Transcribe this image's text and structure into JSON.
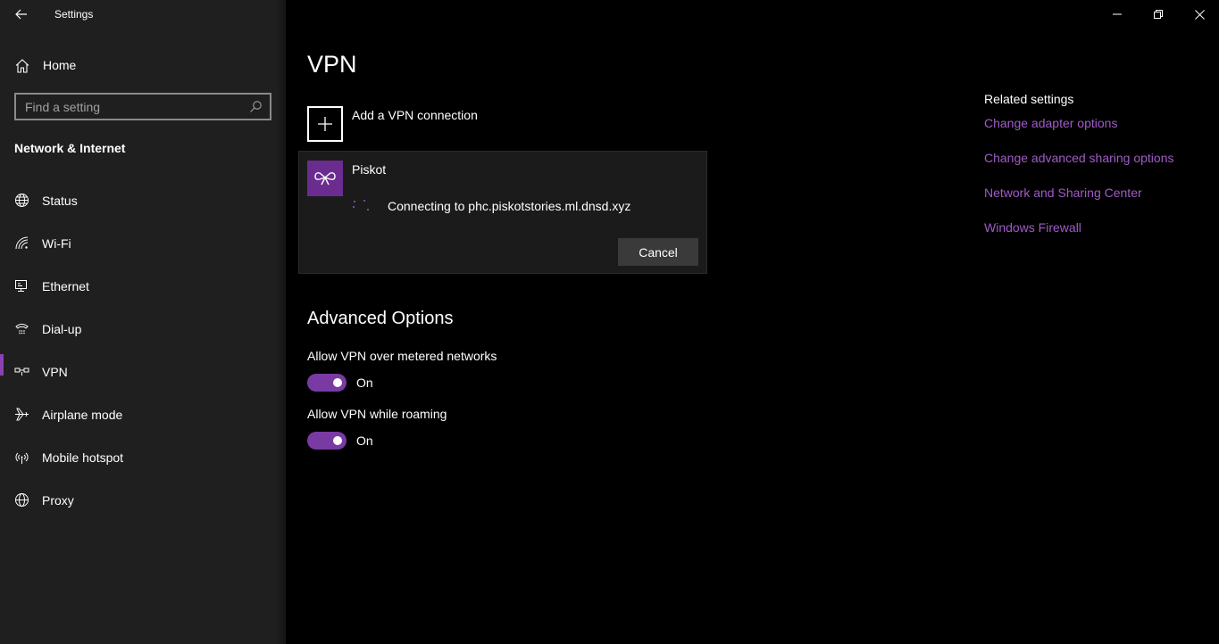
{
  "window": {
    "app_title": "Settings",
    "controls": [
      "minimize-icon",
      "restore-icon",
      "close-icon"
    ]
  },
  "sidebar": {
    "home_label": "Home",
    "search_placeholder": "Find a setting",
    "section_title": "Network & Internet",
    "items": [
      {
        "label": "Status",
        "icon": "globe-status-icon"
      },
      {
        "label": "Wi-Fi",
        "icon": "wifi-icon"
      },
      {
        "label": "Ethernet",
        "icon": "ethernet-icon"
      },
      {
        "label": "Dial-up",
        "icon": "dialup-icon"
      },
      {
        "label": "VPN",
        "icon": "vpn-icon"
      },
      {
        "label": "Airplane mode",
        "icon": "airplane-icon"
      },
      {
        "label": "Mobile hotspot",
        "icon": "hotspot-icon"
      },
      {
        "label": "Proxy",
        "icon": "globe-icon"
      }
    ],
    "active_item": "VPN"
  },
  "main": {
    "title": "VPN",
    "add_vpn_label": "Add a VPN connection",
    "connection": {
      "name": "Piskot",
      "status": "Connecting to phc.piskotstories.ml.dnsd.xyz",
      "cancel_label": "Cancel"
    },
    "advanced_title": "Advanced Options",
    "options": [
      {
        "label": "Allow VPN over metered networks",
        "state": "On"
      },
      {
        "label": "Allow VPN while roaming",
        "state": "On"
      }
    ]
  },
  "related": {
    "title": "Related settings",
    "links": [
      "Change adapter options",
      "Change advanced sharing options",
      "Network and Sharing Center",
      "Windows Firewall"
    ]
  },
  "colors": {
    "accent": "#7a3aa3",
    "link": "#a15bc7",
    "sidebar_bg": "#1f1f1f",
    "main_bg": "#000000"
  }
}
